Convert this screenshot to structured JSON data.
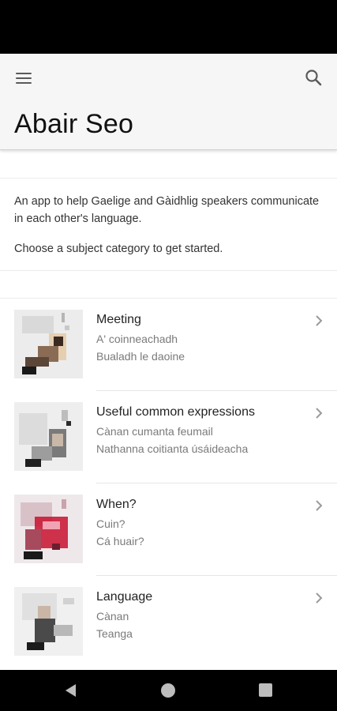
{
  "app": {
    "title": "Abair Seo"
  },
  "intro": {
    "description": "An app to help Gaelige and Gàidhlig speakers communicate in each other's language.",
    "cta": "Choose a subject category to get started."
  },
  "categories": [
    {
      "title": "Meeting",
      "gaidhlig": "A' coinneachadh",
      "gaelige": "Bualadh le daoine",
      "icon": "chevron-right-icon"
    },
    {
      "title": "Useful common expressions",
      "gaidhlig": "Cànan cumanta feumail",
      "gaelige": "Nathanna coitianta úsáideacha",
      "icon": "chevron-right-icon"
    },
    {
      "title": "When?",
      "gaidhlig": "Cuin?",
      "gaelige": "Cá huair?",
      "icon": "chevron-right-icon"
    },
    {
      "title": "Language",
      "gaidhlig": "Cànan",
      "gaelige": "Teanga",
      "icon": "chevron-right-icon"
    }
  ],
  "icons": {
    "menu": "hamburger-menu-icon",
    "search": "search-icon",
    "nav_back": "back-triangle-icon",
    "nav_home": "home-circle-icon",
    "nav_recent": "recent-square-icon"
  },
  "colors": {
    "header_bg": "#f6f6f6",
    "system_bars": "#000000",
    "secondary_text": "#7a7a7a",
    "photo_accent": "#c8102e"
  }
}
